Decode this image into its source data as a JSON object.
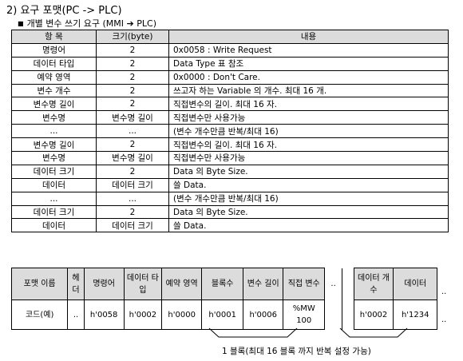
{
  "heading": "2) 요구 포맷(PC -> PLC)",
  "subheading": {
    "bullet": "■",
    "text_before": "개별 변수 쓰기 요구 (MMI ",
    "arrow": "➔",
    "text_after": " PLC)"
  },
  "spec_table": {
    "headers": [
      "항 목",
      "크기(byte)",
      "내용"
    ],
    "rows": [
      [
        "명령어",
        "2",
        "0x0058 : Write Request"
      ],
      [
        "데이터 타입",
        "2",
        "Data Type 표 참조"
      ],
      [
        "예약 영역",
        "2",
        "0x0000 : Don't Care."
      ],
      [
        "변수 개수",
        "2",
        "쓰고자 하는 Variable 의 개수. 최대 16 개."
      ],
      [
        "변수명 길이",
        "2",
        "직접변수의 길이. 최대 16 자."
      ],
      [
        "변수명",
        "변수명 길이",
        "직접변수만 사용가능"
      ],
      [
        "...",
        "...",
        "(변수 개수만큼 반복/최대 16)"
      ],
      [
        "변수명 길이",
        "2",
        "직접변수의 길이. 최대 16 자."
      ],
      [
        "변수명",
        "변수명 길이",
        "직접변수만 사용가능"
      ],
      [
        "데이터 크기",
        "2",
        "Data 의 Byte Size."
      ],
      [
        "데이터",
        "데이터 크기",
        "쓸 Data."
      ],
      [
        "...",
        "...",
        "(변수 개수만큼 반복/최대 16)"
      ],
      [
        "데이터 크기",
        "2",
        "Data 의 Byte Size."
      ],
      [
        "데이터",
        "데이터 크기",
        "쓸 Data."
      ]
    ]
  },
  "frame_table": {
    "headers": [
      "포맷 이름",
      "헤더",
      "명령어",
      "데이터 타입",
      "예약 영역",
      "블록수",
      "변수 길이",
      "직접 변수",
      "..",
      "데이터 개수",
      "데이터"
    ],
    "row_label": "코드(예)",
    "row": [
      "..",
      "h'0058",
      "h'0002",
      "h'0000",
      "h'0001",
      "h'0006",
      "%MW 100",
      "",
      "h'0002",
      "h'1234"
    ],
    "trail_header": "..",
    "trail_row": ".."
  },
  "block_note": "1 블록(최대 16 블록 까지 반복 설정 가능)"
}
